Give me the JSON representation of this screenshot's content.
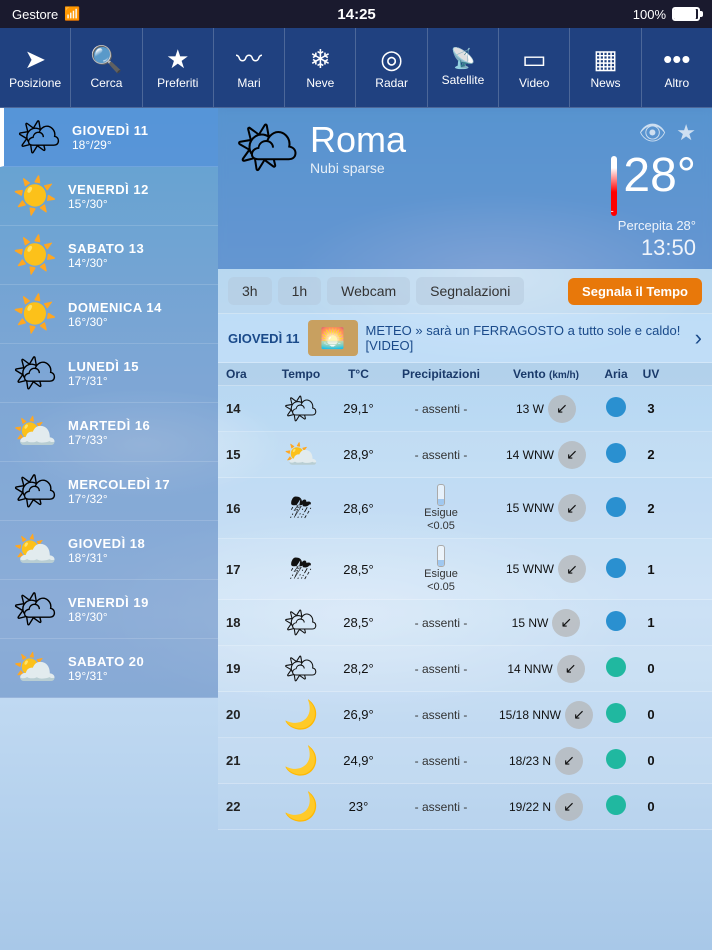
{
  "statusBar": {
    "carrier": "Gestore",
    "signal": "wifi",
    "time": "14:25",
    "battery": "100%"
  },
  "navBar": {
    "items": [
      {
        "id": "posizione",
        "label": "Posizione",
        "icon": "➤"
      },
      {
        "id": "cerca",
        "label": "Cerca",
        "icon": "🔍"
      },
      {
        "id": "preferiti",
        "label": "Preferiti",
        "icon": "★"
      },
      {
        "id": "mari",
        "label": "Mari",
        "icon": "〰"
      },
      {
        "id": "neve",
        "label": "Neve",
        "icon": "❄"
      },
      {
        "id": "radar",
        "label": "Radar",
        "icon": "◎"
      },
      {
        "id": "satellite",
        "label": "Satellite",
        "icon": "📡"
      },
      {
        "id": "video",
        "label": "Video",
        "icon": "▭"
      },
      {
        "id": "news",
        "label": "News",
        "icon": "▦"
      },
      {
        "id": "altro",
        "label": "Altro",
        "icon": "•••"
      }
    ]
  },
  "city": {
    "name": "Roma",
    "condition": "Nubi sparse",
    "temperature": "28°",
    "perceived": "Percepita 28°",
    "time": "13:50",
    "icon": "🌤"
  },
  "tabs": [
    {
      "id": "3h",
      "label": "3h",
      "active": false
    },
    {
      "id": "1h",
      "label": "1h",
      "active": false
    },
    {
      "id": "webcam",
      "label": "Webcam",
      "active": false
    },
    {
      "id": "segnalazioni",
      "label": "Segnalazioni",
      "active": false
    },
    {
      "id": "segnala",
      "label": "Segnala il Tempo",
      "active": false
    }
  ],
  "newsBanner": {
    "date": "GIOVEDÌ 11",
    "text": "METEO » sarà un FERRAGOSTO a tutto sole e caldo! [VIDEO]"
  },
  "tableHeaders": [
    "Ora",
    "Tempo",
    "T°C",
    "Precipitazioni",
    "Vento (km/h)",
    "Aria",
    "UV"
  ],
  "days": [
    {
      "name": "GIOVEDÌ 11",
      "temp": "18°/29°",
      "icon": "🌤",
      "active": true
    },
    {
      "name": "VENERDÌ 12",
      "temp": "15°/30°",
      "icon": "☀️",
      "active": false
    },
    {
      "name": "SABATO 13",
      "temp": "14°/30°",
      "icon": "☀️",
      "active": false
    },
    {
      "name": "DOMENICA 14",
      "temp": "16°/30°",
      "icon": "☀️",
      "active": false
    },
    {
      "name": "LUNEDÌ 15",
      "temp": "17°/31°",
      "icon": "🌤",
      "active": false
    },
    {
      "name": "MARTEDÌ 16",
      "temp": "17°/33°",
      "icon": "⛅",
      "active": false
    },
    {
      "name": "MERCOLEDÌ 17",
      "temp": "17°/32°",
      "icon": "🌤",
      "active": false
    },
    {
      "name": "GIOVEDÌ 18",
      "temp": "18°/31°",
      "icon": "⛅",
      "active": false
    },
    {
      "name": "VENERDÌ 19",
      "temp": "18°/30°",
      "icon": "🌤",
      "active": false
    },
    {
      "name": "SABATO 20",
      "temp": "19°/31°",
      "icon": "⛅",
      "active": false
    }
  ],
  "hourlyData": [
    {
      "ora": "14",
      "icon": "🌤",
      "temp": "29,1°",
      "precip": "- assenti -",
      "precipType": "none",
      "vento": "13 W",
      "aria": "blue",
      "uv": "3"
    },
    {
      "ora": "15",
      "icon": "⛅",
      "temp": "28,9°",
      "precip": "- assenti -",
      "precipType": "none",
      "vento": "14 WNW",
      "aria": "blue",
      "uv": "2"
    },
    {
      "ora": "16",
      "icon": "⛈",
      "temp": "28,6°",
      "precip": "Esigue\n<0.05",
      "precipType": "bar",
      "vento": "15 WNW",
      "aria": "blue",
      "uv": "2"
    },
    {
      "ora": "17",
      "icon": "⛈",
      "temp": "28,5°",
      "precip": "Esigue\n<0.05",
      "precipType": "bar",
      "vento": "15 WNW",
      "aria": "blue",
      "uv": "1"
    },
    {
      "ora": "18",
      "icon": "🌤",
      "temp": "28,5°",
      "precip": "- assenti -",
      "precipType": "none",
      "vento": "15 NW",
      "aria": "blue",
      "uv": "1"
    },
    {
      "ora": "19",
      "icon": "🌤",
      "temp": "28,2°",
      "precip": "- assenti -",
      "precipType": "none",
      "vento": "14 NNW",
      "aria": "teal",
      "uv": "0"
    },
    {
      "ora": "20",
      "icon": "🌙",
      "temp": "26,9°",
      "precip": "- assenti -",
      "precipType": "none",
      "vento": "15/18 NNW",
      "aria": "teal",
      "uv": "0"
    },
    {
      "ora": "21",
      "icon": "🌙",
      "temp": "24,9°",
      "precip": "- assenti -",
      "precipType": "none",
      "vento": "18/23 N",
      "aria": "teal",
      "uv": "0"
    },
    {
      "ora": "22",
      "icon": "🌙",
      "temp": "23°",
      "precip": "- assenti -",
      "precipType": "none",
      "vento": "19/22 N",
      "aria": "teal",
      "uv": "0"
    }
  ]
}
